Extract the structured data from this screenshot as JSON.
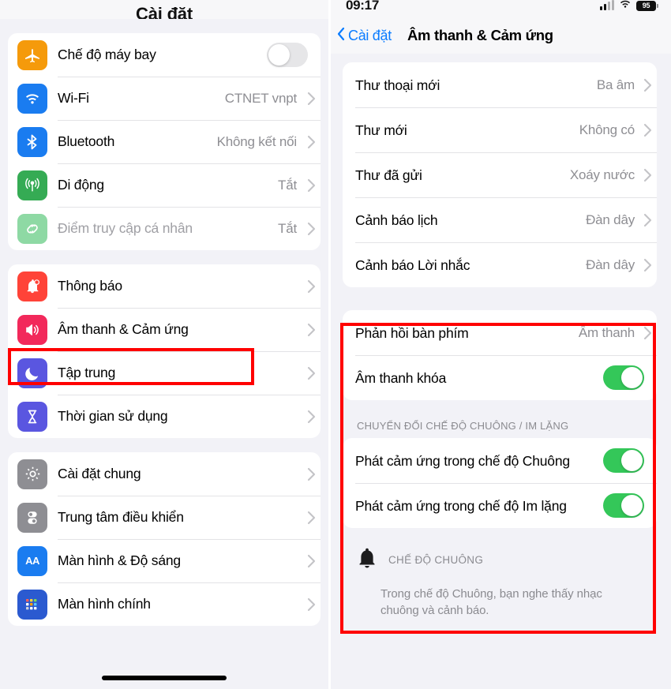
{
  "left_panel": {
    "title": "Cài đặt",
    "groups": [
      {
        "id": "connectivity",
        "rows": [
          {
            "label": "Chế độ máy bay",
            "icon": "airplane-icon",
            "control": "toggle",
            "toggle_on": false,
            "icon_color": "#f59a0b"
          },
          {
            "label": "Wi-Fi",
            "icon": "wifi-icon",
            "control": "chevron",
            "value": "CTNET vnpt",
            "icon_color": "#1a7cf0"
          },
          {
            "label": "Bluetooth",
            "icon": "bluetooth-icon",
            "control": "chevron",
            "value": "Không kết nối",
            "icon_color": "#1a7cf0"
          },
          {
            "label": "Di động",
            "icon": "cellular-icon",
            "control": "chevron",
            "value": "Tắt",
            "icon_color": "#35ab54"
          },
          {
            "label": "Điểm truy cập cá nhân",
            "icon": "hotspot-icon",
            "control": "chevron",
            "value": "Tắt",
            "icon_color": "#8ed9a4",
            "dimmed": true
          }
        ]
      },
      {
        "id": "notifications",
        "rows": [
          {
            "label": "Thông báo",
            "icon": "bell-badge-icon",
            "control": "chevron",
            "value": "",
            "icon_color": "#ff4338"
          },
          {
            "label": "Âm thanh & Cảm ứng",
            "icon": "speaker-icon",
            "control": "chevron",
            "value": "",
            "icon_color": "#f2295b",
            "highlighted": true
          },
          {
            "label": "Tập trung",
            "icon": "moon-icon",
            "control": "chevron",
            "value": "",
            "icon_color": "#5a56e0"
          },
          {
            "label": "Thời gian sử dụng",
            "icon": "hourglass-icon",
            "control": "chevron",
            "value": "",
            "icon_color": "#5a56e0"
          }
        ]
      },
      {
        "id": "general",
        "rows": [
          {
            "label": "Cài đặt chung",
            "icon": "gear-icon",
            "control": "chevron",
            "value": "",
            "icon_color": "#8e8e93"
          },
          {
            "label": "Trung tâm điều khiển",
            "icon": "control-center-icon",
            "control": "chevron",
            "value": "",
            "icon_color": "#8e8e93"
          },
          {
            "label": "Màn hình & Độ sáng",
            "icon": "display-aa-icon",
            "control": "chevron",
            "value": "",
            "icon_color": "#1a7cf0"
          },
          {
            "label": "Màn hình chính",
            "icon": "home-screen-icon",
            "control": "chevron",
            "value": "",
            "icon_color": "#2b5ad0"
          }
        ]
      }
    ]
  },
  "right_panel": {
    "status_bar": {
      "time": "09:17",
      "signal_icon": "cellular-signal-icon",
      "wifi_icon": "wifi-icon",
      "battery_level": "95"
    },
    "nav": {
      "back_label": "Cài đặt",
      "back_icon": "chevron-left-icon",
      "title": "Âm thanh & Cảm ứng"
    },
    "group_tones": [
      {
        "label": "Thư thoại mới",
        "value": "Ba âm"
      },
      {
        "label": "Thư mới",
        "value": "Không có"
      },
      {
        "label": "Thư đã gửi",
        "value": "Xoáy nước"
      },
      {
        "label": "Cảnh báo lịch",
        "value": "Đàn dây"
      },
      {
        "label": "Cảnh báo Lời nhắc",
        "value": "Đàn dây"
      }
    ],
    "group_keyboard": [
      {
        "label": "Phản hồi bàn phím",
        "value": "Âm thanh",
        "control": "chevron"
      },
      {
        "label": "Âm thanh khóa",
        "control": "toggle",
        "toggle_on": true
      }
    ],
    "section_header_ring_silent": "CHUYỂN ĐỔI CHẾ ĐỘ CHUÔNG / IM LẶNG",
    "group_haptics": [
      {
        "label": "Phát cảm ứng trong chế độ Chuông",
        "control": "toggle",
        "toggle_on": true
      },
      {
        "label": "Phát cảm ứng trong chế độ Im lặng",
        "control": "toggle",
        "toggle_on": true
      }
    ],
    "ring_mode": {
      "icon": "bell-icon",
      "label": "CHẾ ĐỘ CHUÔNG",
      "description": "Trong chế độ Chuông, bạn nghe thấy nhạc chuông và cảnh báo."
    }
  },
  "annotations": {
    "highlight_color": "#ff0000",
    "boxes": [
      {
        "id": "redbox-sound-left",
        "target": "Âm thanh & Cảm ứng"
      },
      {
        "id": "redbox-sound-right",
        "target": "keyboard-and-haptics-section"
      }
    ]
  }
}
